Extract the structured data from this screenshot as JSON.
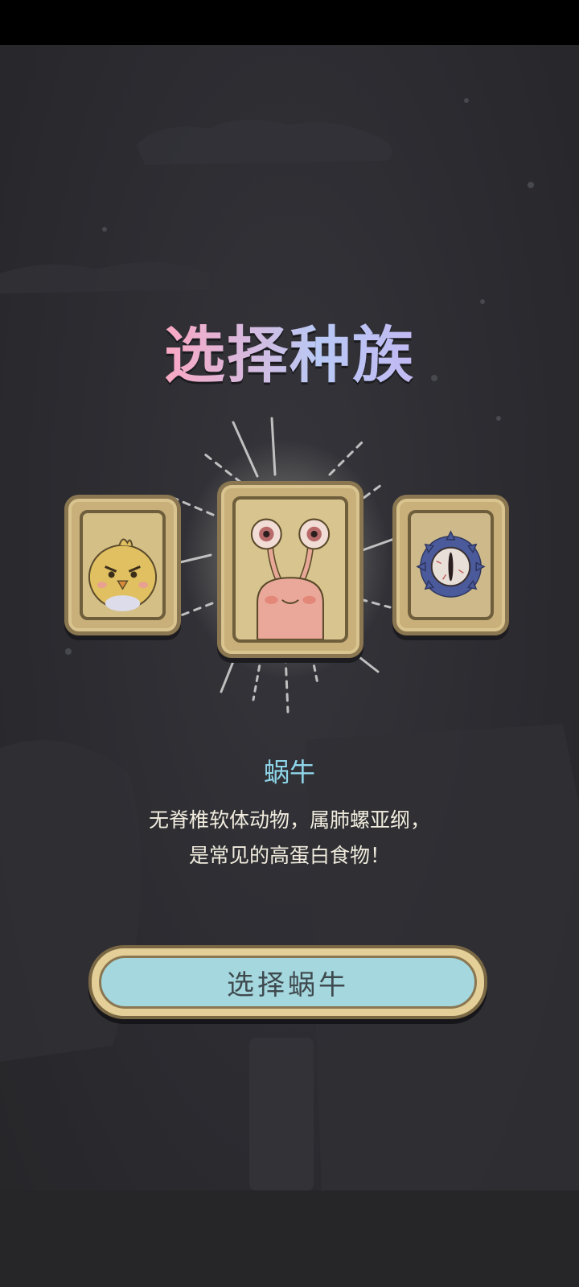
{
  "title": "选择种族",
  "species": {
    "selected_name": "蜗牛",
    "description": "无脊椎软体动物，属肺螺亚纲，\n是常见的高蛋白食物！"
  },
  "cards": [
    {
      "id": "chick",
      "icon": "angry-chick-icon",
      "selected": false
    },
    {
      "id": "snail",
      "icon": "snail-icon",
      "selected": true
    },
    {
      "id": "eye",
      "icon": "spiky-eye-icon",
      "selected": false
    }
  ],
  "select_button": {
    "label": "选择蜗牛"
  },
  "colors": {
    "background": "#2b2b30",
    "name_accent": "#8fd6ea",
    "button_fill": "#a4d7de",
    "card_stone": "#c9b07a"
  }
}
